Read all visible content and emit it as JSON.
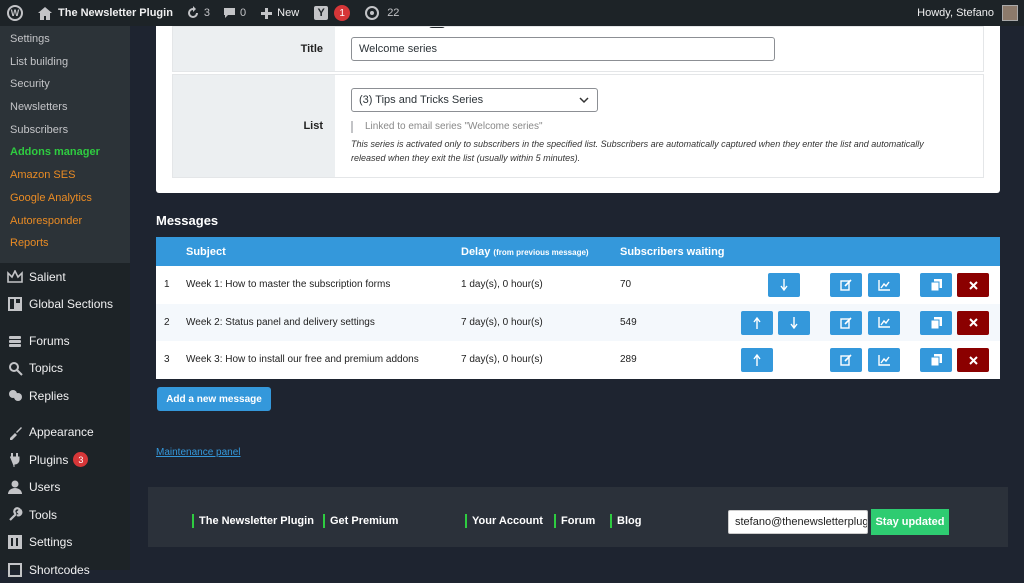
{
  "adminbar": {
    "site_name": "The Newsletter Plugin",
    "updates_count": "3",
    "comments_count": "0",
    "new_label": "New",
    "yoast_badge": "1",
    "extra_count": "22",
    "howdy": "Howdy, Stefano"
  },
  "sidebar": {
    "submenu": [
      "Settings",
      "List building",
      "Security",
      "Newsletters",
      "Subscribers",
      "Addons manager",
      "Amazon SES",
      "Google Analytics",
      "Autoresponder",
      "Reports"
    ],
    "menu": {
      "salient": "Salient",
      "global_sections": "Global Sections",
      "forums": "Forums",
      "topics": "Topics",
      "replies": "Replies",
      "appearance": "Appearance",
      "plugins": "Plugins",
      "plugins_badge": "3",
      "users": "Users",
      "tools": "Tools",
      "settings": "Settings",
      "shortcodes": "Shortcodes"
    }
  },
  "form": {
    "title_label": "Title",
    "title_value": "Welcome series",
    "list_label": "List",
    "list_value": "(3) Tips and Tricks Series",
    "linked_note": "Linked to email series \"Welcome series\"",
    "description": "This series is activated only to subscribers in the specified list. Subscribers are automatically captured when they enter the list and automatically released when they exit the list (usually within 5 minutes)."
  },
  "messages": {
    "title": "Messages",
    "headers": {
      "subject": "Subject",
      "delay": "Delay",
      "delay_note": "(from previous message)",
      "waiting": "Subscribers waiting"
    },
    "rows": [
      {
        "num": "1",
        "subject": "Week 1: How to master the subscription forms",
        "delay": "1 day(s), 0 hour(s)",
        "waiting": "70"
      },
      {
        "num": "2",
        "subject": "Week 2: Status panel and delivery settings",
        "delay": "7 day(s), 0 hour(s)",
        "waiting": "549"
      },
      {
        "num": "3",
        "subject": "Week 3: How to install our free and premium addons",
        "delay": "7 day(s), 0 hour(s)",
        "waiting": "289"
      }
    ],
    "add_button": "Add a new message"
  },
  "maintenance_link": "Maintenance panel",
  "footer": {
    "links": [
      "The Newsletter Plugin",
      "Get Premium",
      "Your Account",
      "Forum",
      "Blog"
    ],
    "email_value": "stefano@thenewsletterplugin.com",
    "stay_updated": "Stay updated"
  },
  "colors": {
    "accent": "#3498db",
    "danger": "#8b0000",
    "green": "#2ecc40",
    "orange": "#e98b24"
  }
}
